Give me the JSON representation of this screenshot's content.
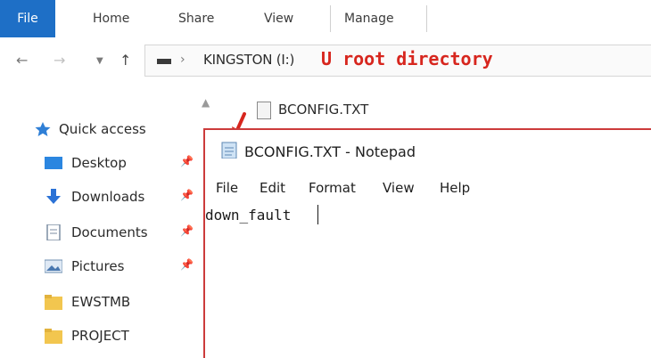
{
  "ribbon": {
    "tabs": [
      {
        "label": "File"
      },
      {
        "label": "Home"
      },
      {
        "label": "Share"
      },
      {
        "label": "View"
      },
      {
        "label": "Manage"
      }
    ],
    "file_tab_color": "#1e6fc6"
  },
  "nav": {
    "back_icon": "arrow-left-icon",
    "forward_icon": "arrow-right-icon",
    "recent_icon": "chevron-down-icon",
    "up_icon": "arrow-up-icon"
  },
  "address": {
    "drive_icon": "usb-drive-icon",
    "path_text": "KINGSTON (I:)",
    "annotation": "U root directory",
    "annotation_color": "#d7261e"
  },
  "sidebar": {
    "items": [
      {
        "label": "Quick access",
        "icon": "star-icon",
        "pinned": false
      },
      {
        "label": "Desktop",
        "icon": "desktop-folder-icon",
        "pinned": true
      },
      {
        "label": "Downloads",
        "icon": "download-icon",
        "pinned": true
      },
      {
        "label": "Documents",
        "icon": "documents-icon",
        "pinned": true
      },
      {
        "label": "Pictures",
        "icon": "pictures-icon",
        "pinned": true
      },
      {
        "label": "EWSTMB",
        "icon": "folder-icon",
        "pinned": false
      },
      {
        "label": "PROJECT",
        "icon": "folder-icon",
        "pinned": false
      }
    ]
  },
  "file_list": {
    "items": [
      {
        "name": "BCONFIG.TXT",
        "icon": "text-file-icon"
      }
    ]
  },
  "notepad": {
    "title": "BCONFIG.TXT - Notepad",
    "menu": [
      "File",
      "Edit",
      "Format",
      "View",
      "Help"
    ],
    "content": "down_fault"
  }
}
